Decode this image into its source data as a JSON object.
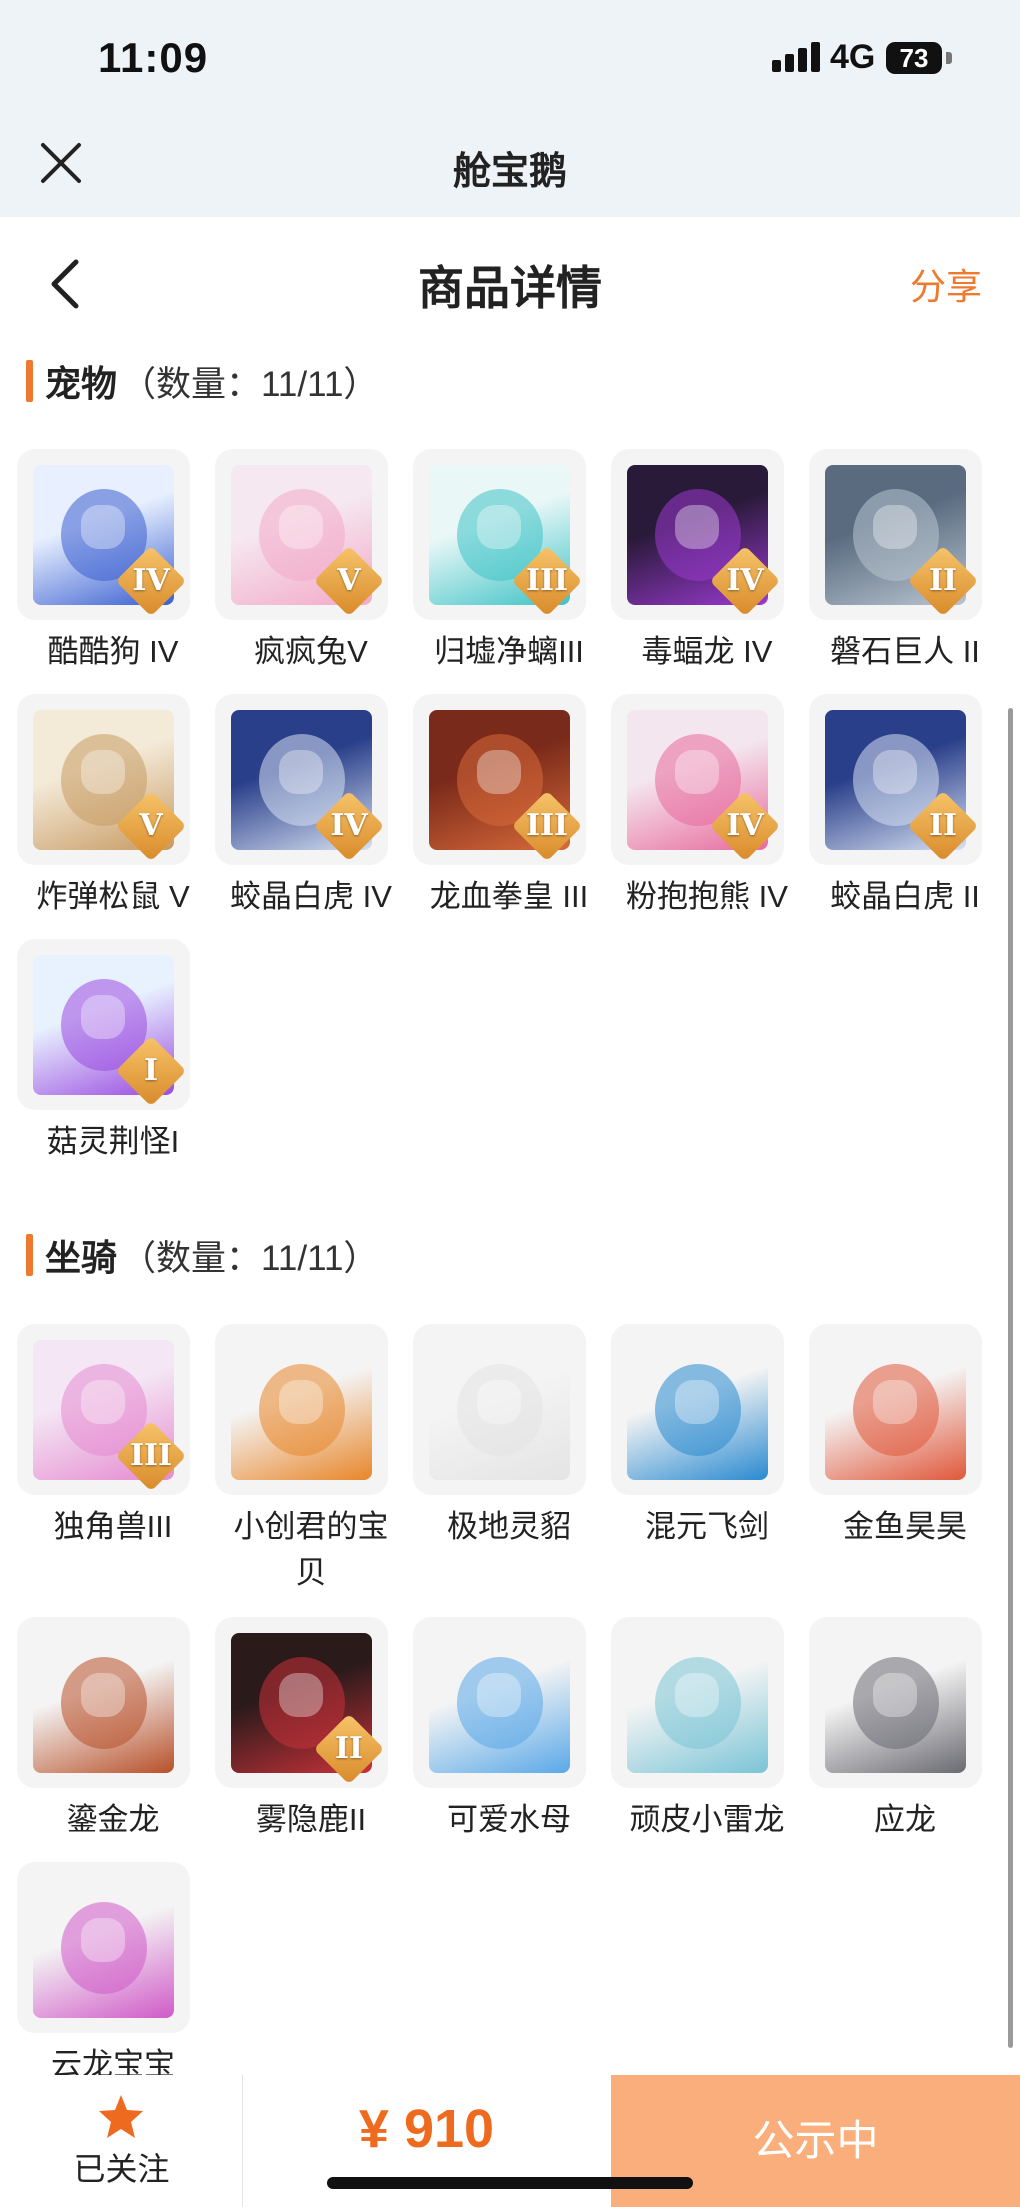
{
  "status_bar": {
    "time": "11:09",
    "network": "4G",
    "battery": "73"
  },
  "mini_program": {
    "title": "舱宝鹅"
  },
  "nav": {
    "title": "商品详情",
    "share_label": "分享"
  },
  "sections": {
    "pets": {
      "title": "宠物",
      "count": "（数量：11/11）",
      "items": [
        {
          "name": "酷酷狗 IV",
          "badge": "IV",
          "icon": "white-dog-with-goggles",
          "colors": [
            "#e8f0ff",
            "#3a5fd0"
          ]
        },
        {
          "name": "疯疯兔V",
          "badge": "V",
          "icon": "pink-bunny",
          "colors": [
            "#f5e8f0",
            "#f3a9c8"
          ]
        },
        {
          "name": "归墟净螭III",
          "badge": "III",
          "icon": "cyan-dragon",
          "colors": [
            "#eaf7f7",
            "#3ec3c6"
          ]
        },
        {
          "name": "毒蝠龙 IV",
          "badge": "IV",
          "icon": "purple-bat-dragon",
          "colors": [
            "#2a1a3a",
            "#9a3ad0"
          ]
        },
        {
          "name": "磐石巨人 II",
          "badge": "II",
          "icon": "rock-giant",
          "colors": [
            "#5a6b80",
            "#b8c4cf"
          ]
        },
        {
          "name": "炸弹松鼠 V",
          "badge": "V",
          "icon": "squirrel",
          "colors": [
            "#f4ead8",
            "#c79a62"
          ]
        },
        {
          "name": "蛟晶白虎 IV",
          "badge": "IV",
          "icon": "white-tiger",
          "colors": [
            "#2a3f8a",
            "#d6e0f2"
          ]
        },
        {
          "name": "龙血拳皇 III",
          "badge": "III",
          "icon": "dragon-blood-fighter",
          "colors": [
            "#7a2a1a",
            "#d86a3a"
          ]
        },
        {
          "name": "粉抱抱熊 IV",
          "badge": "IV",
          "icon": "pink-bear",
          "colors": [
            "#f4e6ee",
            "#e86a9c"
          ]
        },
        {
          "name": "蛟晶白虎 II",
          "badge": "II",
          "icon": "white-tiger",
          "colors": [
            "#2a3f8a",
            "#d6e0f2"
          ]
        },
        {
          "name": "菇灵荆怪I",
          "badge": "I",
          "icon": "purple-hair-sprite",
          "colors": [
            "#e8f2ff",
            "#9a4ae0"
          ]
        }
      ]
    },
    "mounts": {
      "title": "坐骑",
      "count": "（数量：11/11）",
      "items": [
        {
          "name": "独角兽III",
          "badge": "III",
          "icon": "unicorn",
          "colors": [
            "#f4e6f4",
            "#e58ad0"
          ]
        },
        {
          "name": "小创君的宝贝",
          "badge": "",
          "icon": "orange-bird",
          "colors": [
            "#f4f4f4",
            "#e8862a"
          ]
        },
        {
          "name": "极地灵貂",
          "badge": "",
          "icon": "white-fox",
          "colors": [
            "#f4f4f4",
            "#e4e4e4"
          ]
        },
        {
          "name": "混元飞剑",
          "badge": "",
          "icon": "blue-sword",
          "colors": [
            "#f4f4f4",
            "#2a8ad0"
          ]
        },
        {
          "name": "金鱼昊昊",
          "badge": "",
          "icon": "goldfish",
          "colors": [
            "#f4f4f4",
            "#e0573a"
          ]
        },
        {
          "name": "鎏金龙",
          "badge": "",
          "icon": "golden-dragon",
          "colors": [
            "#f4f4f4",
            "#b8502a"
          ]
        },
        {
          "name": "雾隐鹿II",
          "badge": "II",
          "icon": "red-deer",
          "colors": [
            "#2a1a1a",
            "#c8323a"
          ]
        },
        {
          "name": "可爱水母",
          "badge": "",
          "icon": "jellyfish",
          "colors": [
            "#f4f4f4",
            "#5aa8e8"
          ]
        },
        {
          "name": "顽皮小雷龙",
          "badge": "",
          "icon": "blue-dino",
          "colors": [
            "#f4f4f4",
            "#7ac4d6"
          ]
        },
        {
          "name": "应龙",
          "badge": "",
          "icon": "grey-dragon",
          "colors": [
            "#f4f4f4",
            "#6a6a72"
          ]
        },
        {
          "name": "云龙宝宝",
          "badge": "",
          "icon": "winged-baby-dragon",
          "colors": [
            "#f4f4f4",
            "#d05ac8"
          ]
        }
      ]
    }
  },
  "bottom": {
    "follow_label": "已关注",
    "price": "¥ 910",
    "public_label": "公示中"
  }
}
